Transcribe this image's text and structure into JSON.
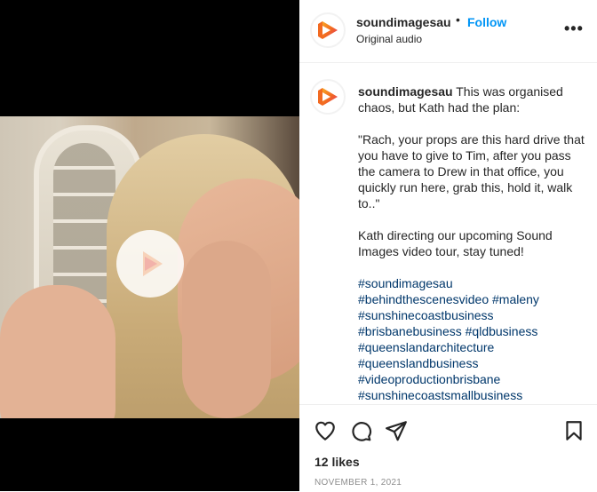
{
  "post": {
    "username": "soundimagesau",
    "follow_label": "Follow",
    "separator": "•",
    "audio_label": "Original audio",
    "more_label": "•••"
  },
  "caption": {
    "username": "soundimagesau",
    "line1": " This was organised chaos, but Kath had the plan:",
    "quote": "\"Rach, your props are this hard drive that you have to give to Tim, after you pass the camera to Drew in that office, you quickly run here, grab this, hold it, walk to..\"",
    "line3": "Kath directing our upcoming Sound Images video tour, stay tuned!",
    "hashtags": [
      "#soundimagesau",
      "#behindthescenesvideo",
      "#maleny",
      "#sunshinecoastbusiness",
      "#brisbanebusiness",
      "#qldbusiness",
      "#queenslandarchitecture",
      "#queenslandbusiness",
      "#videoproductionbrisbane",
      "#sunshinecoastsmallbusiness"
    ]
  },
  "stats": {
    "likes": "12 likes",
    "date": "NOVEMBER 1, 2021"
  },
  "colors": {
    "accent": "#0095f6",
    "hashtag": "#00376b",
    "brand_orange": "#f26a21",
    "brand_pink": "#e1306c"
  },
  "icons": [
    "heart-icon",
    "comment-icon",
    "share-icon",
    "bookmark-icon",
    "play-icon",
    "more-icon"
  ]
}
